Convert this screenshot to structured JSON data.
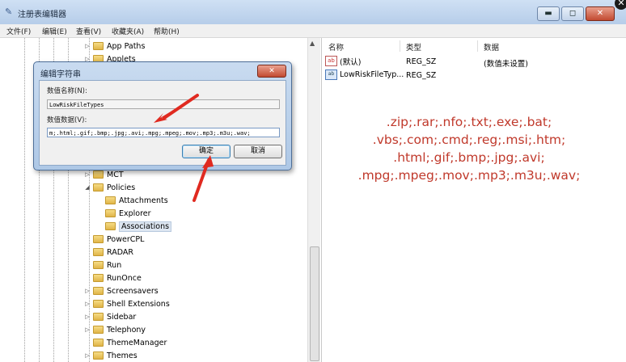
{
  "window": {
    "title": "注册表编辑器",
    "btn_min": "▬",
    "btn_max": "◻",
    "btn_close": "✕",
    "corner_close": "✕"
  },
  "menu": [
    "文件(F)",
    "编辑(E)",
    "查看(V)",
    "收藏夹(A)",
    "帮助(H)"
  ],
  "tree_items": [
    "App Paths",
    "Applets",
    "MCT",
    "Policies",
    "Attachments",
    "Explorer",
    "Associations",
    "PowerCPL",
    "RADAR",
    "Run",
    "RunOnce",
    "Screensavers",
    "Shell Extensions",
    "Sidebar",
    "Telephony",
    "ThemeManager",
    "Themes"
  ],
  "list": {
    "columns": [
      "名称",
      "类型",
      "数据"
    ],
    "rows": [
      {
        "name": "(默认)",
        "type": "REG_SZ",
        "data": "(数值未设置)",
        "icon": "ab"
      },
      {
        "name": "LowRiskFileTyp...",
        "type": "REG_SZ",
        "data": "",
        "icon": "bin"
      }
    ]
  },
  "overlay_lines": [
    ".zip;.rar;.nfo;.txt;.exe;.bat;",
    ".vbs;.com;.cmd;.reg;.msi;.htm;",
    ".html;.gif;.bmp;.jpg;.avi;",
    ".mpg;.mpeg;.mov;.mp3;.m3u;.wav;"
  ],
  "dialog": {
    "title": "编辑字符串",
    "close": "✕",
    "name_label": "数值名称(N):",
    "name_value": "LowRiskFileTypes",
    "data_label": "数值数据(V):",
    "data_value": "m;.html;.gif;.bmp;.jpg;.avi;.mpg;.mpeg;.mov;.mp3;.m3u;.wav;",
    "ok": "确定",
    "cancel": "取消"
  },
  "colors": {
    "annotation": "#c0392b",
    "titlebar": "#b6cde9"
  }
}
